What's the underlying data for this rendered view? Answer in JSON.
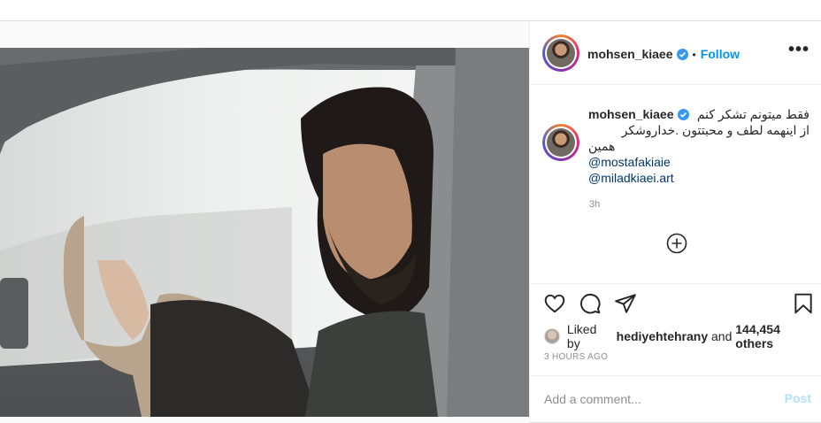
{
  "post": {
    "author": {
      "username": "mohsen_kiaee",
      "verified": true,
      "follow_label": "Follow",
      "separator": "•"
    },
    "more_label": "•••",
    "caption": {
      "line1": "فقط میتونم تشکر کنم",
      "line2": "از اینهمه لطف و محبتتون .خداروشکر",
      "line3": "همین",
      "mentions": [
        "@mostafakiaie",
        "@miladkiaei.art"
      ],
      "time": "3h"
    },
    "actions": {
      "like_icon": "heart-icon",
      "comment_icon": "comment-icon",
      "share_icon": "paper-plane-icon",
      "save_icon": "bookmark-icon",
      "add_icon": "plus-circle-icon"
    },
    "likes": {
      "prefix": "Liked by",
      "user": "hediyehtehrany",
      "and": "and",
      "others": "144,454 others"
    },
    "timestamp": "3 HOURS AGO",
    "comment": {
      "placeholder": "Add a comment...",
      "post_label": "Post"
    }
  },
  "colors": {
    "accent": "#0095f6",
    "verified": "#3897f0",
    "muted": "#8e8e8e",
    "post_disabled": "#b2dffc"
  }
}
